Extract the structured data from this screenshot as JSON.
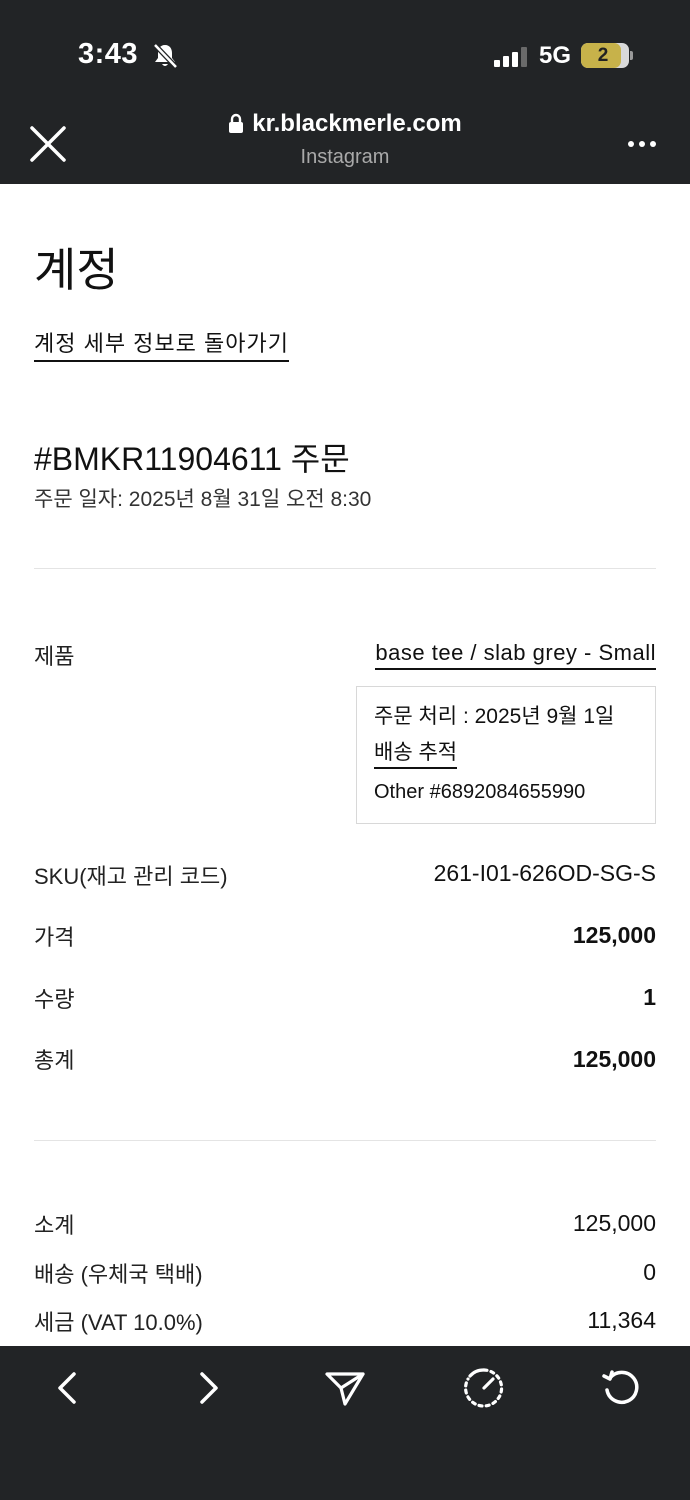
{
  "status_bar": {
    "time": "3:43",
    "network": "5G",
    "battery": "2"
  },
  "browser": {
    "url": "kr.blackmerle.com",
    "source": "Instagram"
  },
  "page": {
    "title": "계정",
    "back_link": "계정 세부 정보로 돌아가기",
    "order_number": "#BMKR11904611 주문",
    "order_date": "주문 일자: 2025년 8월 31일 오전 8:30"
  },
  "line_item": {
    "product_label": "제품",
    "product_name": "base tee / slab grey - Small",
    "fulfillment": {
      "status": "주문 처리 : 2025년 9월 1일",
      "tracking_link": "배송 추적",
      "tracking_number": "Other #6892084655990"
    },
    "sku_label": "SKU(재고 관리 코드)",
    "sku": "261-I01-626OD-SG-S",
    "price_label": "가격",
    "price": "125,000",
    "quantity_label": "수량",
    "quantity": "1",
    "total_label": "총계",
    "total": "125,000"
  },
  "summary": {
    "subtotal_label": "소계",
    "subtotal": "125,000",
    "shipping_label": "배송 (우체국 택배)",
    "shipping": "0",
    "tax_label": "세금 (VAT 10.0%)",
    "tax": "11,364"
  },
  "toolbar": {
    "icons": [
      "chevron-left-icon",
      "chevron-right-icon",
      "send-icon",
      "safari-compass-icon",
      "reload-icon"
    ]
  }
}
